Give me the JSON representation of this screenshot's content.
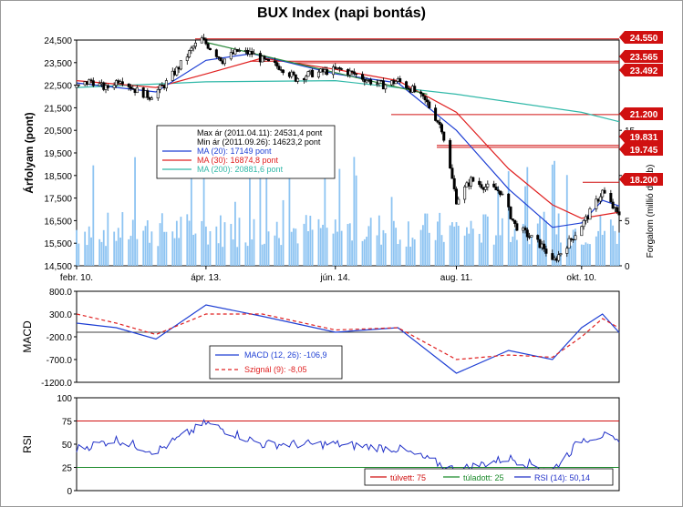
{
  "title": "BUX Index (napi bontás)",
  "colors": {
    "candle_up": "#ffffff",
    "candle_down": "#000000",
    "ma20": "#1e3fd4",
    "ma30": "#e02020",
    "ma200": "#30b8a8",
    "volume": "#8ec4f2",
    "trend": "#2e8b3e",
    "hline": "#d01010",
    "macd": "#1e3fd4",
    "signal": "#e02020",
    "rsi": "#2030c8",
    "rsi_overbought": "#d01010",
    "rsi_oversold": "#1a8a2a"
  },
  "chart_data": [
    {
      "id": "price",
      "type": "line",
      "subtype": "candlestick_with_volume",
      "ylabel": "Árfolyam (pont)",
      "y2label": "Forgalom (millió darab)",
      "ylim": [
        14500,
        24500
      ],
      "yticks": [
        "24,500",
        "23,500",
        "22,500",
        "21,500",
        "20,500",
        "19,500",
        "18,500",
        "17,500",
        "16,500",
        "15,500",
        "14,500"
      ],
      "y2lim": [
        0,
        25
      ],
      "y2ticks": [
        "0",
        "5",
        "10",
        "15"
      ],
      "x_labels": [
        "febr. 10.",
        "ápr. 13.",
        "jún. 14.",
        "aug. 11.",
        "okt. 10."
      ],
      "date_range": [
        "2011-02-10",
        "2011-10-28"
      ],
      "series_weekly_close": [
        {
          "date": "2011-02-10",
          "close": 22400
        },
        {
          "date": "2011-02-17",
          "close": 22700
        },
        {
          "date": "2011-02-24",
          "close": 22350
        },
        {
          "date": "2011-03-03",
          "close": 22800
        },
        {
          "date": "2011-03-10",
          "close": 22300
        },
        {
          "date": "2011-03-17",
          "close": 22000
        },
        {
          "date": "2011-03-24",
          "close": 22500
        },
        {
          "date": "2011-03-31",
          "close": 23300
        },
        {
          "date": "2011-04-07",
          "close": 24200
        },
        {
          "date": "2011-04-11",
          "close": 24531
        },
        {
          "date": "2011-04-21",
          "close": 23600
        },
        {
          "date": "2011-04-28",
          "close": 24000
        },
        {
          "date": "2011-05-05",
          "close": 23900
        },
        {
          "date": "2011-05-12",
          "close": 23500
        },
        {
          "date": "2011-05-19",
          "close": 23300
        },
        {
          "date": "2011-05-26",
          "close": 22800
        },
        {
          "date": "2011-06-02",
          "close": 23000
        },
        {
          "date": "2011-06-09",
          "close": 23100
        },
        {
          "date": "2011-06-16",
          "close": 23200
        },
        {
          "date": "2011-06-23",
          "close": 23000
        },
        {
          "date": "2011-06-30",
          "close": 22700
        },
        {
          "date": "2011-07-07",
          "close": 22500
        },
        {
          "date": "2011-07-14",
          "close": 22700
        },
        {
          "date": "2011-07-21",
          "close": 22300
        },
        {
          "date": "2011-07-28",
          "close": 21700
        },
        {
          "date": "2011-08-04",
          "close": 20600
        },
        {
          "date": "2011-08-11",
          "close": 17400
        },
        {
          "date": "2011-08-18",
          "close": 18300
        },
        {
          "date": "2011-08-25",
          "close": 18000
        },
        {
          "date": "2011-09-01",
          "close": 17800
        },
        {
          "date": "2011-09-08",
          "close": 16300
        },
        {
          "date": "2011-09-15",
          "close": 15800
        },
        {
          "date": "2011-09-22",
          "close": 15300
        },
        {
          "date": "2011-09-26",
          "close": 14623
        },
        {
          "date": "2011-10-06",
          "close": 15800
        },
        {
          "date": "2011-10-13",
          "close": 16700
        },
        {
          "date": "2011-10-20",
          "close": 17800
        },
        {
          "date": "2011-10-27",
          "close": 16800
        }
      ],
      "ma_lines": {
        "ma200": [
          {
            "date": "2011-02-10",
            "value": 22400
          },
          {
            "date": "2011-04-13",
            "value": 22650
          },
          {
            "date": "2011-06-14",
            "value": 22700
          },
          {
            "date": "2011-08-11",
            "value": 22100
          },
          {
            "date": "2011-10-10",
            "value": 21300
          },
          {
            "date": "2011-10-28",
            "value": 20882
          }
        ],
        "ma30": [
          {
            "date": "2011-02-10",
            "value": 22700
          },
          {
            "date": "2011-03-20",
            "value": 22400
          },
          {
            "date": "2011-04-13",
            "value": 23000
          },
          {
            "date": "2011-05-10",
            "value": 23700
          },
          {
            "date": "2011-06-14",
            "value": 23200
          },
          {
            "date": "2011-07-14",
            "value": 22700
          },
          {
            "date": "2011-08-11",
            "value": 21300
          },
          {
            "date": "2011-09-05",
            "value": 18800
          },
          {
            "date": "2011-09-26",
            "value": 17200
          },
          {
            "date": "2011-10-10",
            "value": 16600
          },
          {
            "date": "2011-10-28",
            "value": 16875
          }
        ],
        "ma20": [
          {
            "date": "2011-02-10",
            "value": 22600
          },
          {
            "date": "2011-03-20",
            "value": 22200
          },
          {
            "date": "2011-04-13",
            "value": 23600
          },
          {
            "date": "2011-05-05",
            "value": 23900
          },
          {
            "date": "2011-06-14",
            "value": 23000
          },
          {
            "date": "2011-07-14",
            "value": 22600
          },
          {
            "date": "2011-08-11",
            "value": 20500
          },
          {
            "date": "2011-09-05",
            "value": 17900
          },
          {
            "date": "2011-09-26",
            "value": 16200
          },
          {
            "date": "2011-10-10",
            "value": 16400
          },
          {
            "date": "2011-10-20",
            "value": 17400
          },
          {
            "date": "2011-10-28",
            "value": 17149
          }
        ]
      },
      "trendline": [
        {
          "date": "2011-04-13",
          "value": 24400
        },
        {
          "date": "2011-07-28",
          "value": 22100
        }
      ],
      "price_levels": [
        "24.550",
        "23.565",
        "23.492",
        "21.200",
        "19.831",
        "19.745",
        "18.200"
      ],
      "price_level_values": [
        24550,
        23565,
        23492,
        21200,
        19831,
        19745,
        18200
      ],
      "legend": {
        "lines": [
          "Max ár (2011.04.11): 24531,4 pont",
          "Min ár (2011.09.26): 14623,2 pont"
        ],
        "series": [
          {
            "label": "MA (20): 17149 pont",
            "color_key": "ma20"
          },
          {
            "label": "MA (30): 16874,8 pont",
            "color_key": "ma30"
          },
          {
            "label": "MA (200): 20881,6 pont",
            "color_key": "ma200"
          }
        ]
      }
    },
    {
      "id": "macd",
      "type": "line",
      "ylabel": "MACD",
      "ylim": [
        -1200,
        800
      ],
      "yticks": [
        "800.0",
        "300.0",
        "-200.0",
        "-700.0",
        "-1200.0"
      ],
      "series": [
        {
          "name": "MACD (12, 26): -106,9",
          "style": "solid",
          "color_key": "macd",
          "points": [
            {
              "date": "2011-02-10",
              "value": 100
            },
            {
              "date": "2011-03-01",
              "value": 0
            },
            {
              "date": "2011-03-20",
              "value": -250
            },
            {
              "date": "2011-04-13",
              "value": 500
            },
            {
              "date": "2011-05-10",
              "value": 250
            },
            {
              "date": "2011-06-14",
              "value": -100
            },
            {
              "date": "2011-07-14",
              "value": 0
            },
            {
              "date": "2011-08-11",
              "value": -1000
            },
            {
              "date": "2011-09-05",
              "value": -500
            },
            {
              "date": "2011-09-26",
              "value": -700
            },
            {
              "date": "2011-10-10",
              "value": 0
            },
            {
              "date": "2011-10-20",
              "value": 300
            },
            {
              "date": "2011-10-28",
              "value": -107
            }
          ]
        },
        {
          "name": "Szignál (9): -8,05",
          "style": "dashed",
          "color_key": "signal",
          "points": [
            {
              "date": "2011-02-10",
              "value": 300
            },
            {
              "date": "2011-03-01",
              "value": 100
            },
            {
              "date": "2011-03-20",
              "value": -150
            },
            {
              "date": "2011-04-13",
              "value": 300
            },
            {
              "date": "2011-05-10",
              "value": 300
            },
            {
              "date": "2011-06-14",
              "value": -50
            },
            {
              "date": "2011-07-14",
              "value": 0
            },
            {
              "date": "2011-08-11",
              "value": -700
            },
            {
              "date": "2011-09-05",
              "value": -600
            },
            {
              "date": "2011-09-26",
              "value": -650
            },
            {
              "date": "2011-10-10",
              "value": -200
            },
            {
              "date": "2011-10-20",
              "value": 200
            },
            {
              "date": "2011-10-28",
              "value": -8
            }
          ]
        }
      ]
    },
    {
      "id": "rsi",
      "type": "line",
      "ylabel": "RSI",
      "ylim": [
        0,
        100
      ],
      "yticks": [
        "100",
        "75",
        "50",
        "25",
        "0"
      ],
      "overbought": 75,
      "oversold": 25,
      "series": [
        {
          "name": "RSI (14): 50,14",
          "color_key": "rsi",
          "points": [
            {
              "date": "2011-02-10",
              "value": 45
            },
            {
              "date": "2011-03-01",
              "value": 55
            },
            {
              "date": "2011-03-20",
              "value": 42
            },
            {
              "date": "2011-04-13",
              "value": 73
            },
            {
              "date": "2011-05-10",
              "value": 50
            },
            {
              "date": "2011-06-14",
              "value": 50
            },
            {
              "date": "2011-07-14",
              "value": 45
            },
            {
              "date": "2011-08-11",
              "value": 22
            },
            {
              "date": "2011-09-05",
              "value": 35
            },
            {
              "date": "2011-09-26",
              "value": 22
            },
            {
              "date": "2011-10-10",
              "value": 55
            },
            {
              "date": "2011-10-20",
              "value": 60
            },
            {
              "date": "2011-10-28",
              "value": 50
            }
          ]
        }
      ],
      "legend": [
        "túlvett: 75",
        "túladott: 25",
        "RSI (14): 50,14"
      ]
    }
  ]
}
